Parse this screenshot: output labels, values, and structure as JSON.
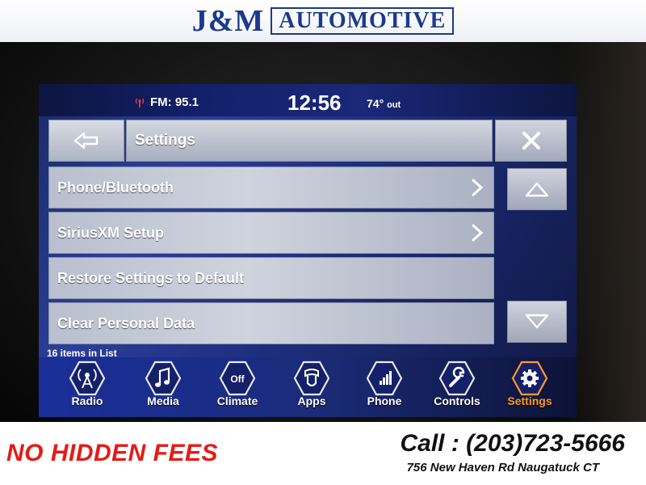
{
  "banner": {
    "brand": "J&M",
    "brand_sub": "AUTOMOTIVE"
  },
  "status_bar": {
    "fm": "FM: 95.1",
    "clock": "12:56",
    "temp": "74°",
    "temp_unit": "out"
  },
  "header": {
    "title": "Settings"
  },
  "list": {
    "items": [
      {
        "label": "Phone/Bluetooth",
        "has_chevron": true
      },
      {
        "label": "SiriusXM Setup",
        "has_chevron": true
      },
      {
        "label": "Restore Settings to Default",
        "has_chevron": false
      },
      {
        "label": "Clear Personal Data",
        "has_chevron": false
      }
    ],
    "count_text": "16 items in List"
  },
  "nav": {
    "items": [
      {
        "label": "Radio",
        "icon": "radio-icon"
      },
      {
        "label": "Media",
        "icon": "music-note-icon"
      },
      {
        "label": "Climate",
        "icon": "climate-off-icon",
        "icon_text": "Off"
      },
      {
        "label": "Apps",
        "icon": "apps-icon"
      },
      {
        "label": "Phone",
        "icon": "phone-signal-icon"
      },
      {
        "label": "Controls",
        "icon": "wrench-icon"
      },
      {
        "label": "Settings",
        "icon": "gear-icon",
        "active": true
      }
    ]
  },
  "promo": {
    "left": "NO HIDDEN FEES",
    "phone": "Call : (203)723-5666",
    "address": "756 New Haven Rd Naugatuck CT"
  },
  "colors": {
    "brand": "#1b3a8c",
    "accent_active": "#ff9a2a",
    "promo_red": "#e41b17",
    "fm_icon": "#ff3a3a"
  }
}
